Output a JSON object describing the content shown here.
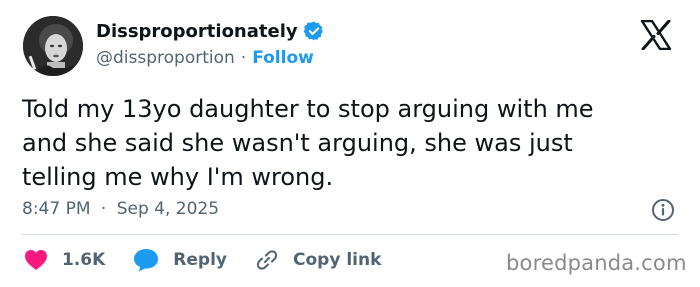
{
  "author": {
    "display_name": "Dissproportionately",
    "handle": "@dissproportion",
    "separator": "·",
    "follow_label": "Follow",
    "verified_icon": "verified-badge-icon",
    "avatar_icon": "avatar"
  },
  "brand_icon": "x-logo-icon",
  "tweet": {
    "text_line1": "Told my 13yo daughter to stop arguing with me",
    "text_line2": "and she said she wasn't arguing, she was just",
    "text_line3": "telling me why I'm wrong.",
    "time": "8:47 PM",
    "date_separator": "·",
    "date": "Sep 4, 2025"
  },
  "actions": {
    "likes": "1.6K",
    "reply_label": "Reply",
    "copy_link_label": "Copy link"
  },
  "watermark": "boredpanda.com",
  "colors": {
    "accent": "#1d9bf0",
    "like": "#f91880",
    "text": "#0f1419",
    "muted": "#536471"
  }
}
